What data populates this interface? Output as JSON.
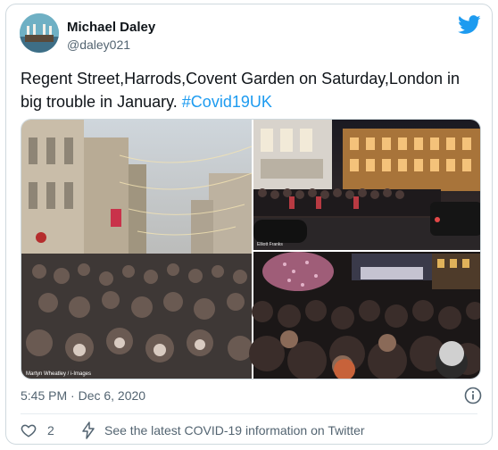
{
  "author": {
    "name": "Michael Daley",
    "handle": "@daley021"
  },
  "tweet": {
    "text": "Regent Street,Harrods,Covent Garden on Saturday,London in big trouble in January.",
    "hashtag": "#Covid19UK",
    "timestamp": "5:45 PM · Dec 6, 2020"
  },
  "media": {
    "photo_credit": "Martyn Wheatley / i-Images",
    "photo_credit_2": "Elliott Franks"
  },
  "footer": {
    "like_count": "2",
    "covid_info": "See the latest COVID-19 information on Twitter"
  },
  "icons": {
    "bird": "twitter-bird-icon",
    "info": "info-icon",
    "heart": "heart-icon",
    "bolt": "lightning-icon"
  },
  "colors": {
    "accent": "#1d9bf0",
    "muted": "#536471",
    "border": "#cfd9de"
  }
}
